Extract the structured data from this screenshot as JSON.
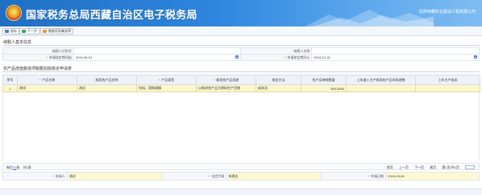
{
  "header": {
    "title": "国家税务总局西藏自治区电子税务局",
    "company": "拉萨西藏实业建设工程有限公司",
    "brand_color": "#2e86de"
  },
  "toolbar": {
    "buttons": [
      {
        "label": "保存",
        "icon": "save-icon"
      },
      {
        "label": "下一步",
        "icon": "next-icon"
      },
      {
        "label": "数据项采集说明",
        "icon": "help-icon"
      }
    ]
  },
  "taxpayer_section": {
    "title": "纳税人基本信息",
    "taxpayer_id_label": "纳税人识别号",
    "taxpayer_id_value": "",
    "taxpayer_name_label": "纳税人名称",
    "taxpayer_name_value": "",
    "period_start_label": "申请核定期间起",
    "period_start_value": "2019-06-01",
    "period_end_label": "申请核定期间止",
    "period_end_value": "2019-12-31"
  },
  "product_section": {
    "title": "农产品增值税进项税额扣除核定申请表",
    "columns": [
      "序号",
      "产品名称",
      "耗用农产品名称",
      "产品类型",
      "耗用农产品用途",
      "核定方法",
      "农产品单耗数量",
      "上年度入主产耗用农产品年购进数",
      "上年主产成本"
    ],
    "rows": [
      {
        "index": "1",
        "product_name": "测试",
        "raw_name": "测试",
        "product_type": "饮料、酒和酒精",
        "usage": "以购进农产品为原料生产货物",
        "method": "成本法",
        "unit_consumption": "500.0000",
        "last_year_purchase": "",
        "last_year_cost": ""
      }
    ]
  },
  "pager": {
    "page_size_prefix": "每页",
    "page_size": "10",
    "page_size_suffix": "条",
    "total": "共1条",
    "first": "首页",
    "prev": "上一页",
    "next": "下一页",
    "last": "尾页",
    "page_info": "第1页/共1页",
    "items_label": "显示",
    "jump": "跳至"
  },
  "footer": {
    "applicant_label": "申请人",
    "applicant_value": "测试",
    "legal_rep_label": "法定代表",
    "legal_rep_value": "朱德志",
    "apply_date_label": "申请日期",
    "apply_date_value": "2019-09-06"
  }
}
